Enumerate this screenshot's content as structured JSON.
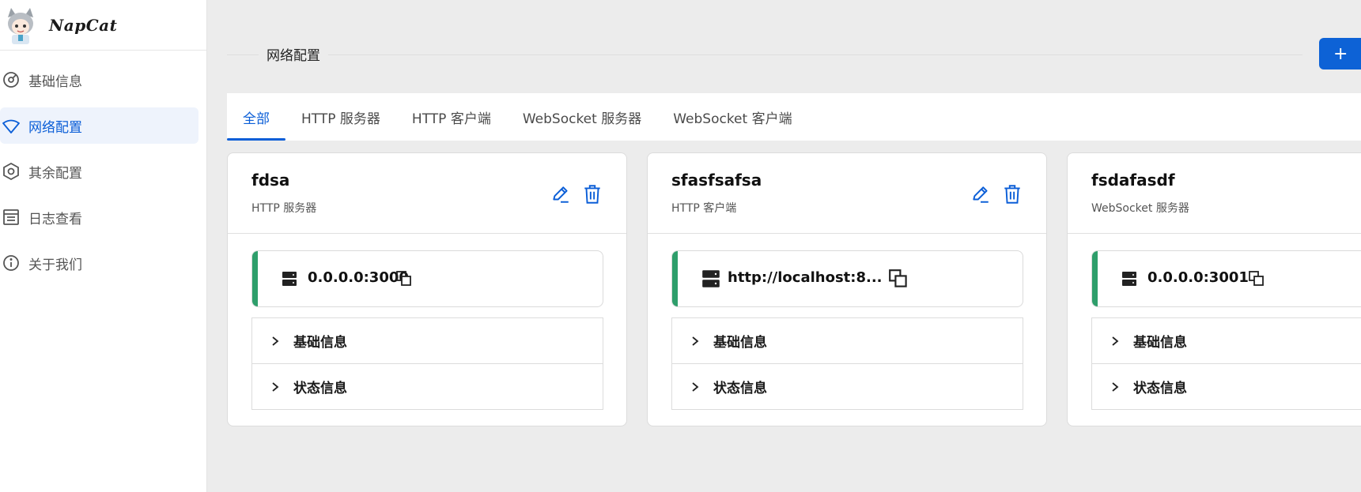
{
  "app": {
    "name": "NapCat"
  },
  "sidebar": {
    "items": [
      {
        "label": "基础信息",
        "icon": "gauge-icon",
        "active": false
      },
      {
        "label": "网络配置",
        "icon": "wifi-icon",
        "active": true
      },
      {
        "label": "其余配置",
        "icon": "hexagon-settings-icon",
        "active": false
      },
      {
        "label": "日志查看",
        "icon": "log-list-icon",
        "active": false
      },
      {
        "label": "关于我们",
        "icon": "info-icon",
        "active": false
      }
    ]
  },
  "header": {
    "title": "网络配置",
    "add_button_label": "+"
  },
  "tabs": [
    {
      "label": "全部",
      "active": true
    },
    {
      "label": "HTTP 服务器",
      "active": false
    },
    {
      "label": "HTTP 客户端",
      "active": false
    },
    {
      "label": "WebSocket 服务器",
      "active": false
    },
    {
      "label": "WebSocket 客户端",
      "active": false
    }
  ],
  "cards": [
    {
      "name": "fdsa",
      "type": "HTTP 服务器",
      "address": "0.0.0.0:3000",
      "sections": [
        "基础信息",
        "状态信息"
      ]
    },
    {
      "name": "sfasfsafsa",
      "type": "HTTP 客户端",
      "address": "http://localhost:8...",
      "sections": [
        "基础信息",
        "状态信息"
      ]
    },
    {
      "name": "fsdafasdf",
      "type": "WebSocket 服务器",
      "address": "0.0.0.0:3001",
      "sections": [
        "基础信息",
        "状态信息"
      ]
    }
  ],
  "colors": {
    "primary": "#0b5ed7",
    "accent_green": "#2e9e6b",
    "background": "#ececec"
  }
}
